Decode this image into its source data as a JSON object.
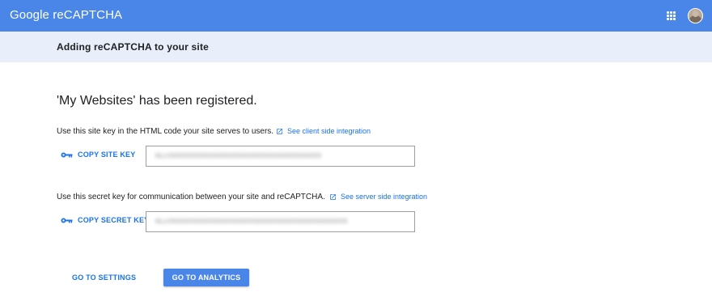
{
  "header": {
    "brand": "Google reCAPTCHA",
    "apps_icon": "grid-apps-icon",
    "avatar_icon": "user-avatar"
  },
  "subheader": {
    "title": "Adding reCAPTCHA to your site"
  },
  "main": {
    "registered_title": "'My Websites' has been registered.",
    "site_key": {
      "description": "Use this site key in the HTML code your site serves to users.",
      "link_label": "See client side integration",
      "link_icon": "open-in-new-icon",
      "copy_label": "COPY SITE KEY",
      "copy_icon": "key-icon",
      "value": "6LcXXXXXXXXXXXXXXXXXXXXXXXXXXXXXXXXXXX"
    },
    "secret_key": {
      "description": "Use this secret key for communication between your site and reCAPTCHA.",
      "link_label": "See server side integration",
      "link_icon": "open-in-new-icon",
      "copy_label": "COPY SECRET KEY",
      "copy_icon": "key-icon",
      "value": "6LcXXXXXXXXXXXXXXXXXXXXXXXXXXXXXXXXXXXXXXXXX"
    }
  },
  "actions": {
    "settings_label": "GO TO SETTINGS",
    "analytics_label": "GO TO ANALYTICS"
  },
  "colors": {
    "header_bg": "#4a86e8",
    "subheader_bg": "#e8effb",
    "link": "#1a73e8"
  }
}
